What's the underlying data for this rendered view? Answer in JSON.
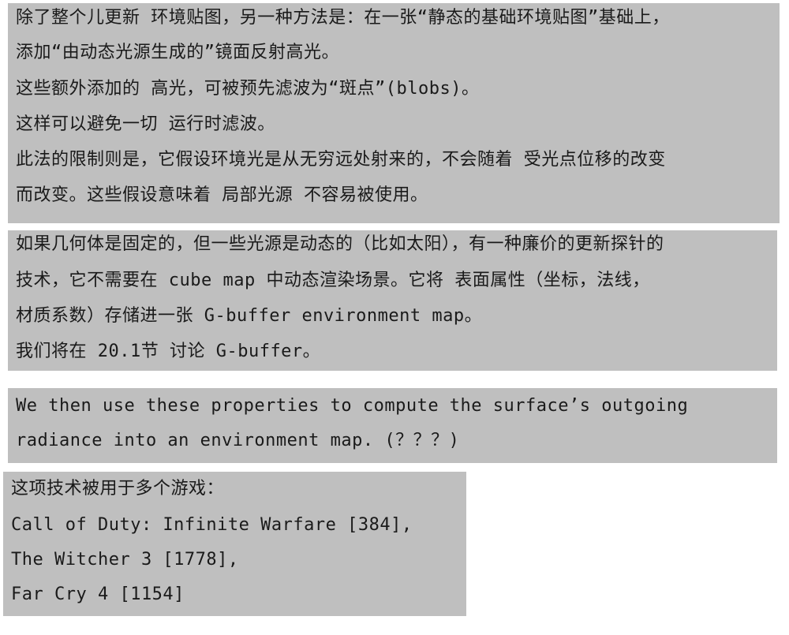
{
  "blocks": [
    {
      "lines": [
        "除了整个儿更新 环境贴图，另一种方法是：在一张“静态的基础环境贴图”基础上，",
        "添加“由动态光源生成的”镜面反射高光。",
        "这些额外添加的 高光，可被预先滤波为“斑点”(blobs)。",
        "这样可以避免一切 运行时滤波。",
        "此法的限制则是，它假设环境光是从无穷远处射来的，不会随着 受光点位移的改变",
        "而改变。这些假设意味着 局部光源 不容易被使用。"
      ]
    },
    {
      "lines": [
        "如果几何体是固定的，但一些光源是动态的（比如太阳），有一种廉价的更新探针的",
        "技术，它不需要在 cube map 中动态渲染场景。它将 表面属性（坐标，法线，",
        "材质系数）存储进一张 G-buffer environment map。",
        "我们将在 20.1节 讨论 G-buffer。"
      ]
    },
    {
      "lines": [
        "We then use these properties to compute the surface’s outgoing",
        "radiance into an environment map. (？？？)"
      ]
    },
    {
      "lines": [
        "这项技术被用于多个游戏：",
        "Call of Duty: Infinite Warfare [384],",
        "The Witcher 3 [1778],",
        "Far Cry 4 [1154]"
      ]
    }
  ]
}
